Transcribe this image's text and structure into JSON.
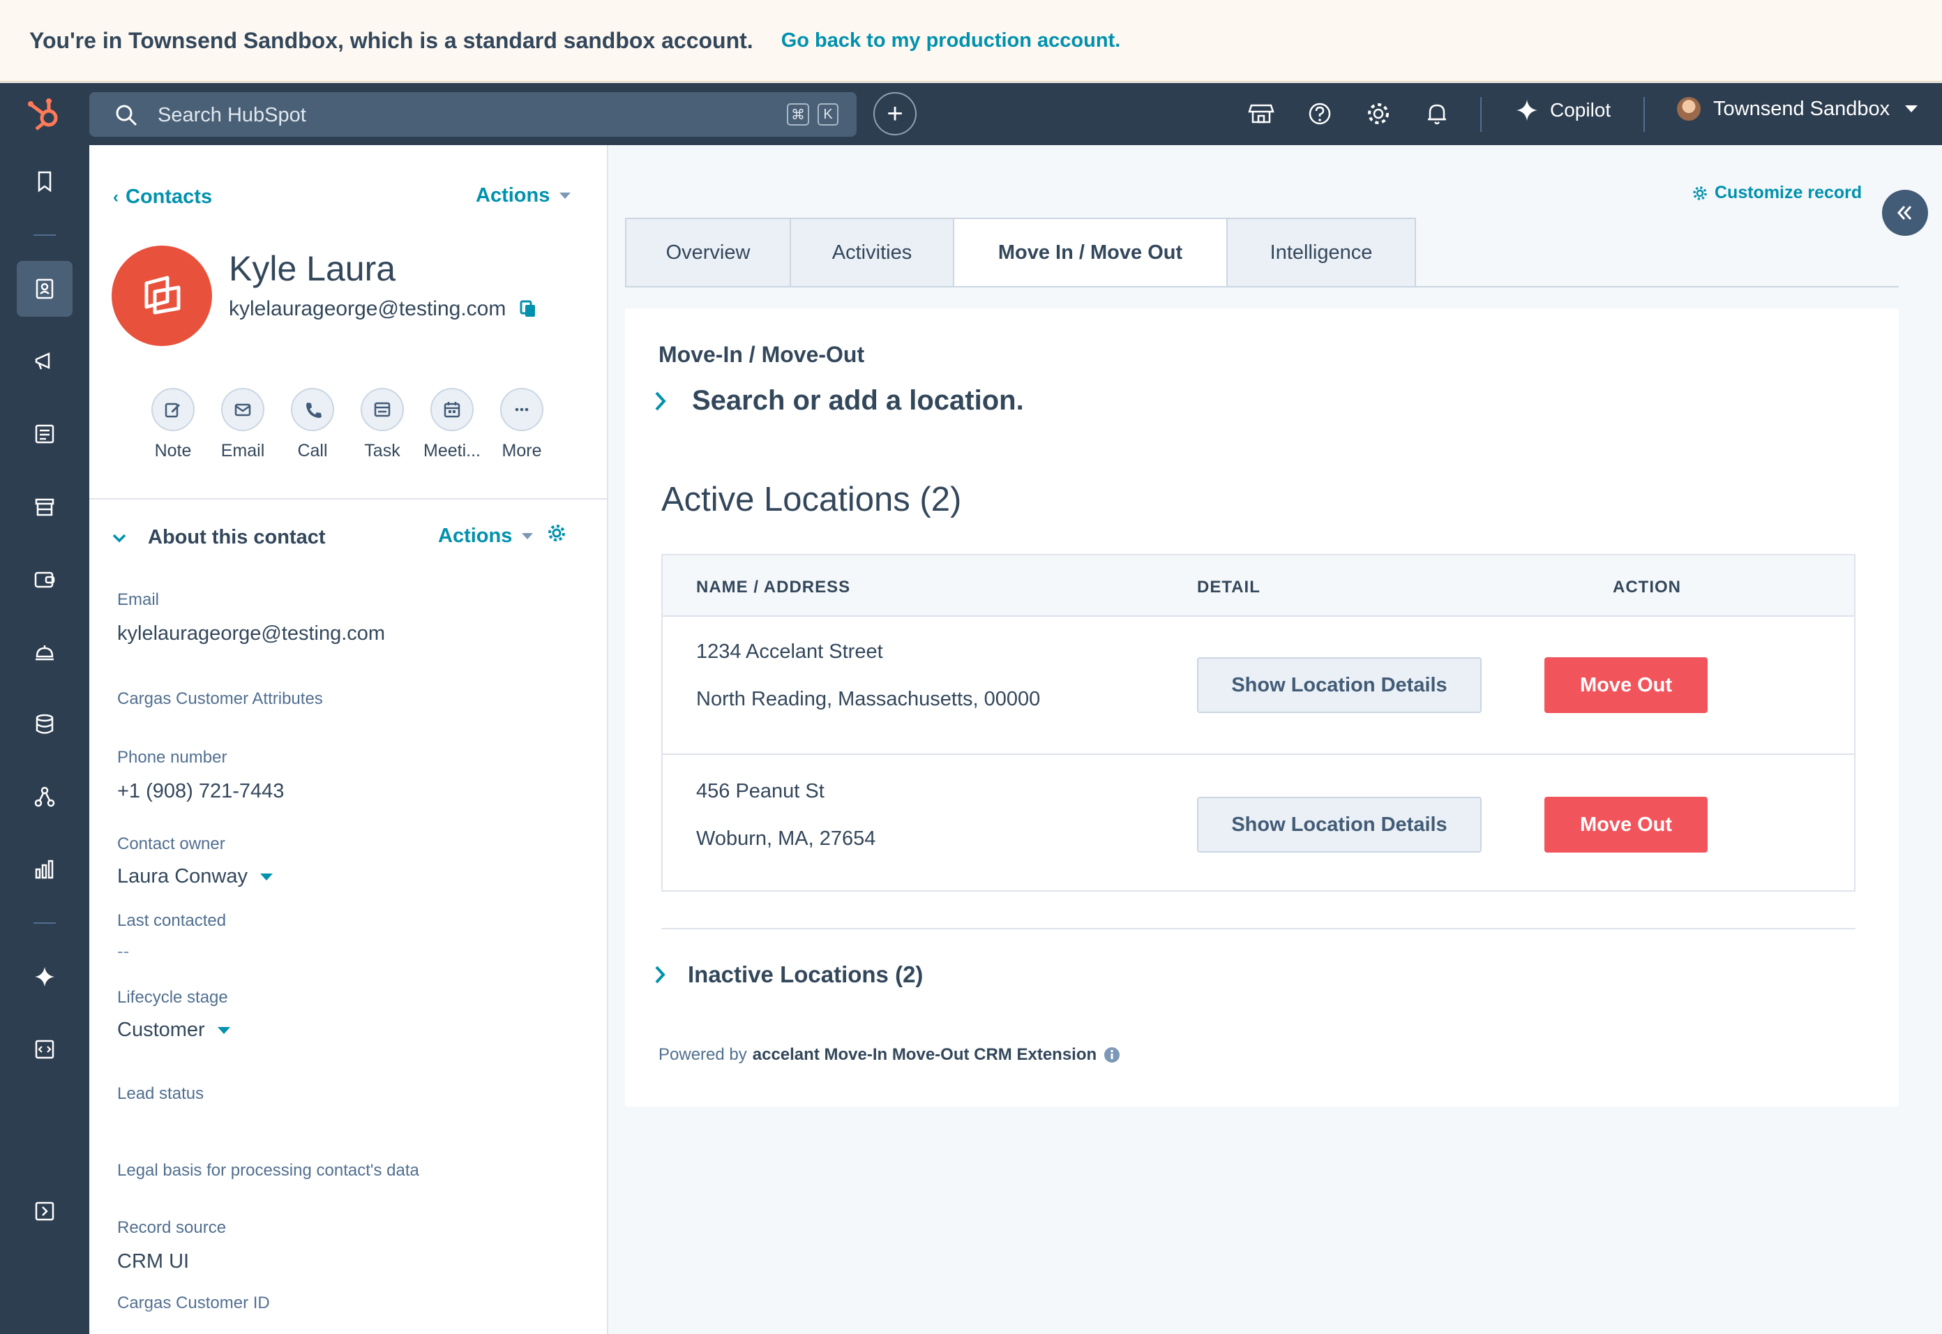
{
  "banner": {
    "text": "You're in Townsend Sandbox, which is a standard sandbox account.",
    "link": "Go back to my production account."
  },
  "topnav": {
    "search_placeholder": "Search HubSpot",
    "shortcut_keys": [
      "⌘",
      "K"
    ],
    "copilot_label": "Copilot",
    "account_name": "Townsend Sandbox"
  },
  "sidebar": {
    "icons": [
      "bookmark-icon",
      "contacts-icon",
      "marketing-icon",
      "content-icon",
      "commerce-icon",
      "sales-icon",
      "service-icon",
      "data-icon",
      "automation-icon",
      "reporting-icon",
      "breeze-icon",
      "development-icon",
      "expand-icon"
    ]
  },
  "record": {
    "back_label": "Contacts",
    "actions_label": "Actions",
    "name": "Kyle Laura",
    "email": "kylelaurageorge@testing.com",
    "quick_actions": [
      "Note",
      "Email",
      "Call",
      "Task",
      "Meeti...",
      "More"
    ]
  },
  "about": {
    "title": "About this contact",
    "actions_label": "Actions",
    "properties": [
      {
        "label": "Email",
        "value": "kylelaurageorge@testing.com"
      },
      {
        "label": "Cargas Customer Attributes",
        "value": ""
      },
      {
        "label": "Phone number",
        "value": "+1 (908) 721-7443"
      },
      {
        "label": "Contact owner",
        "value": "Laura Conway"
      },
      {
        "label": "Last contacted",
        "value": "--"
      },
      {
        "label": "Lifecycle stage",
        "value": "Customer"
      },
      {
        "label": "Lead status",
        "value": ""
      },
      {
        "label": "Legal basis for processing contact's data",
        "value": ""
      },
      {
        "label": "Record source",
        "value": "CRM UI"
      },
      {
        "label": "Cargas Customer ID",
        "value": ""
      }
    ]
  },
  "main": {
    "customize_label": "Customize record",
    "tabs": [
      "Overview",
      "Activities",
      "Move In / Move Out",
      "Intelligence"
    ],
    "active_tab": "Move In / Move Out"
  },
  "card": {
    "title": "Move-In / Move-Out",
    "search_label": "Search or add a location.",
    "active_title": "Active Locations (2)",
    "columns": [
      "NAME / ADDRESS",
      "DETAIL",
      "ACTION"
    ],
    "rows": [
      {
        "line1": "1234 Accelant Street",
        "line2": "North Reading, Massachusetts, 00000",
        "detail_button": "Show Location Details",
        "action_button": "Move Out"
      },
      {
        "line1": "456 Peanut St",
        "line2": "Woburn, MA, 27654",
        "detail_button": "Show Location Details",
        "action_button": "Move Out"
      }
    ],
    "inactive_title": "Inactive Locations (2)",
    "powered_prefix": "Powered by",
    "powered_name": "accelant Move-In Move-Out CRM Extension"
  },
  "colors": {
    "nav_bg": "#2d3e50",
    "accent": "#0091ae",
    "avatar": "#e8513b",
    "danger": "#f2545b",
    "logo": "#ff7a59"
  }
}
